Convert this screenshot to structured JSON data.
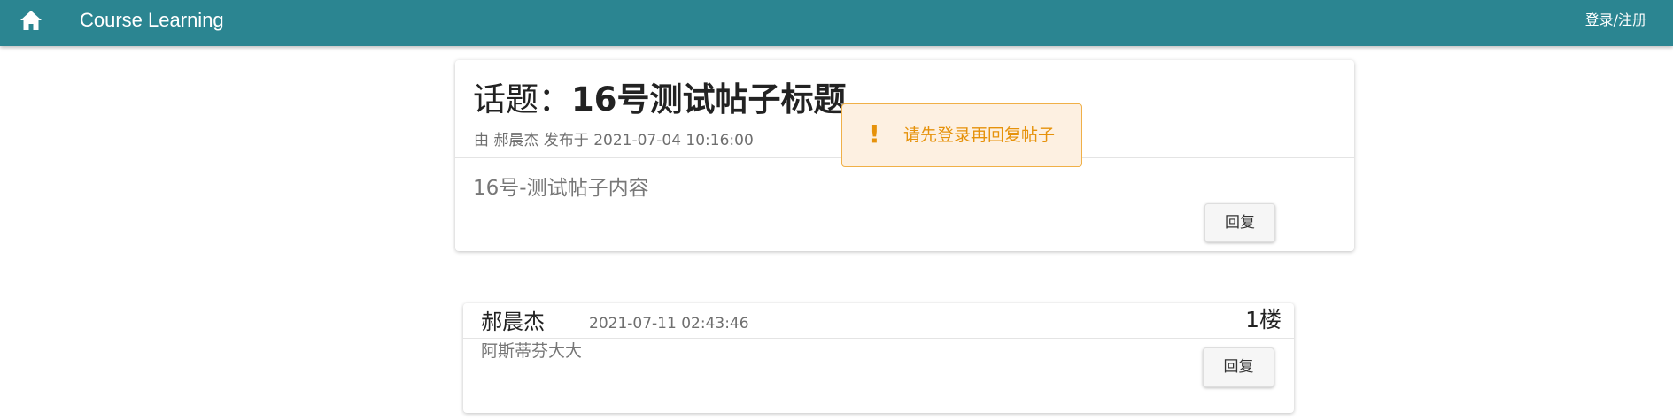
{
  "header": {
    "brand": "Course Learning",
    "login_label": "登录/注册",
    "bar_color": "#2b8591",
    "home_icon": "home-icon"
  },
  "topic": {
    "title_prefix": "话题：",
    "title": "16号测试帖子标题",
    "meta": "由 郝晨杰 发布于 2021-07-04 10:16:00",
    "content": "16号-测试帖子内容",
    "reply_label": "回复"
  },
  "toast": {
    "icon": "!",
    "message": "请先登录再回复帖子",
    "color": "#e6920b",
    "background": "#fdf0e1"
  },
  "replies": [
    {
      "author": "郝晨杰",
      "time": "2021-07-11 02:43:46",
      "floor": "1楼",
      "content": "阿斯蒂芬大大",
      "reply_label": "回复"
    }
  ]
}
